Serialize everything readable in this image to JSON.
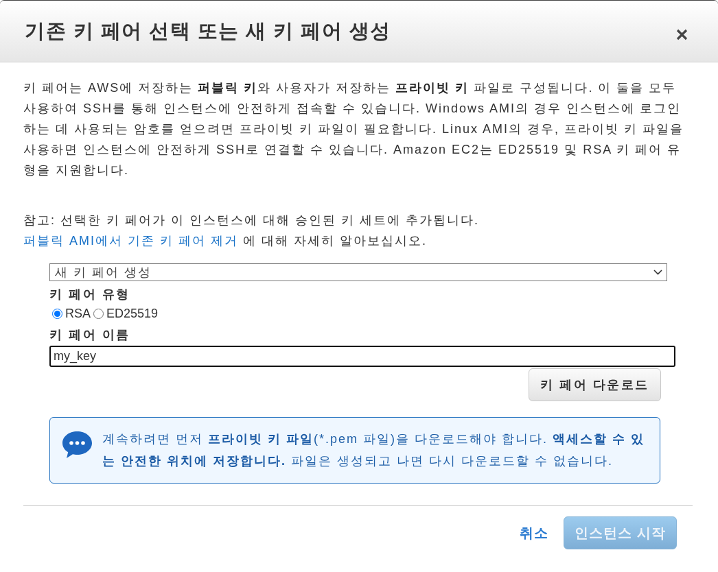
{
  "dialog": {
    "title": "기존 키 페어 선택 또는 새 키 페어 생성"
  },
  "intro": "키 페어는 AWS에 저장하는 **퍼블릭 키**와 사용자가 저장하는 **프라이빗 키** 파일로 구성됩니다. 이 둘을 모두 사용하여 SSH를 통해 인스턴스에 안전하게 접속할 수 있습니다. Windows AMI의 경우 인스턴스에 로그인하는 데 사용되는 암호를 얻으려면 프라이빗 키 파일이 필요합니다. Linux AMI의 경우, 프라이빗 키 파일을 사용하면 인스턴스에 안전하게 SSH로 연결할 수 있습니다. Amazon EC2는 ED25519 및 RSA 키 페어 유형을 지원합니다.",
  "note": {
    "text": "참고: 선택한 키 페어가 이 인스턴스에 대해 승인된 키 세트에 추가됩니다.",
    "link": "퍼블릭 AMI에서 기존 키 페어 제거",
    "after": "에 대해 자세히 알아보십시오."
  },
  "key_pair_select": {
    "value": "새 키 페어 생성"
  },
  "key_type": {
    "label": "키 페어 유형",
    "options": [
      {
        "label": "RSA",
        "selected": true
      },
      {
        "label": "ED25519",
        "selected": false
      }
    ]
  },
  "key_name": {
    "label": "키 페어 이름",
    "value": "my_key"
  },
  "download_button": "키 페어 다운로드",
  "info": {
    "segments": [
      {
        "text": "계속하려면 먼저 ",
        "bold": false
      },
      {
        "text": "프라이빗 키 파일",
        "bold": true
      },
      {
        "text": "(*.pem 파일)을 다운로드해야 합니다. ",
        "bold": false
      },
      {
        "text": "액세스할 수 있는 안전한 위치에 저장합니다.",
        "bold": true
      },
      {
        "text": " 파일은 생성되고 나면 다시 다운로드할 수 없습니다.",
        "bold": false
      }
    ]
  },
  "footer": {
    "cancel": "취소",
    "launch": {
      "label": "인스턴스 시작",
      "disabled": true
    }
  }
}
